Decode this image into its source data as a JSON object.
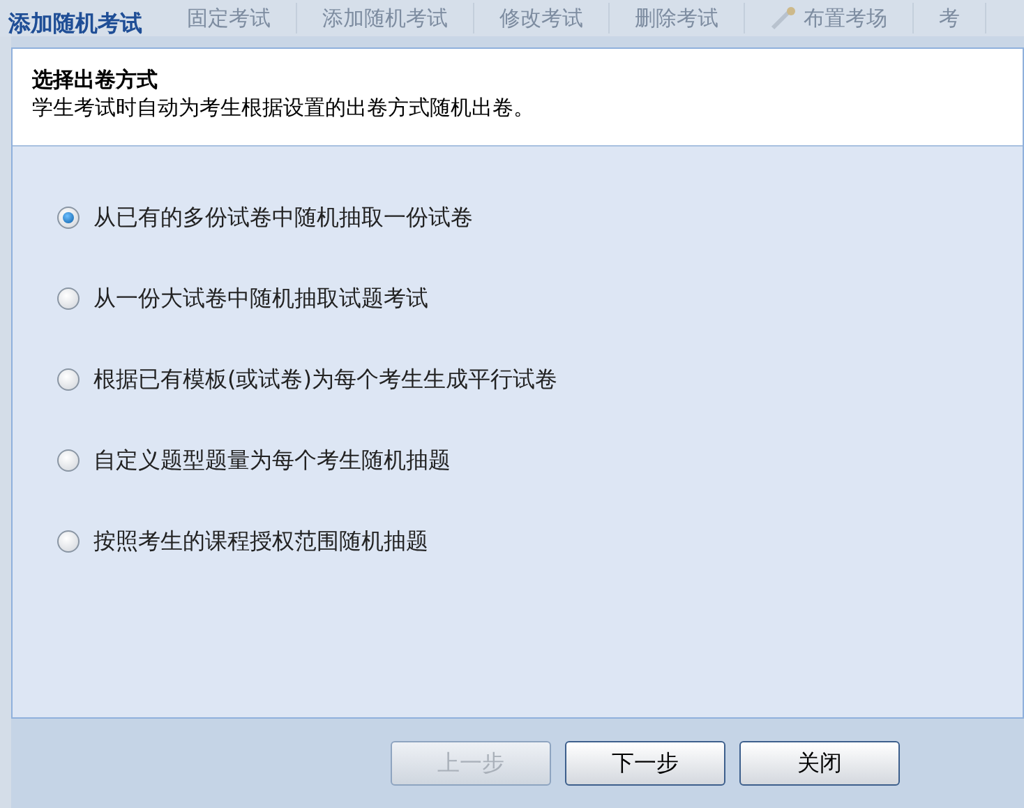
{
  "background_toolbar": [
    {
      "label": "固定考试",
      "kind": "text"
    },
    {
      "label": "添加随机考试",
      "kind": "text"
    },
    {
      "label": "修改考试",
      "kind": "text"
    },
    {
      "label": "删除考试",
      "kind": "text"
    },
    {
      "label": "布置考场",
      "kind": "icon"
    },
    {
      "label": "考",
      "kind": "text"
    }
  ],
  "dialog": {
    "title": "添加随机考试",
    "heading": "选择出卷方式",
    "description": "学生考试时自动为考生根据设置的出卷方式随机出卷。",
    "options": [
      {
        "label": "从已有的多份试卷中随机抽取一份试卷",
        "selected": true
      },
      {
        "label": "从一份大试卷中随机抽取试题考试",
        "selected": false
      },
      {
        "label": "根据已有模板(或试卷)为每个考生生成平行试卷",
        "selected": false
      },
      {
        "label": "自定义题型题量为每个考生随机抽题",
        "selected": false
      },
      {
        "label": "按照考生的课程授权范围随机抽题",
        "selected": false
      }
    ],
    "buttons": [
      {
        "label": "上一步",
        "disabled": true
      },
      {
        "label": "下一步",
        "disabled": false
      },
      {
        "label": "关闭",
        "disabled": false
      }
    ]
  }
}
